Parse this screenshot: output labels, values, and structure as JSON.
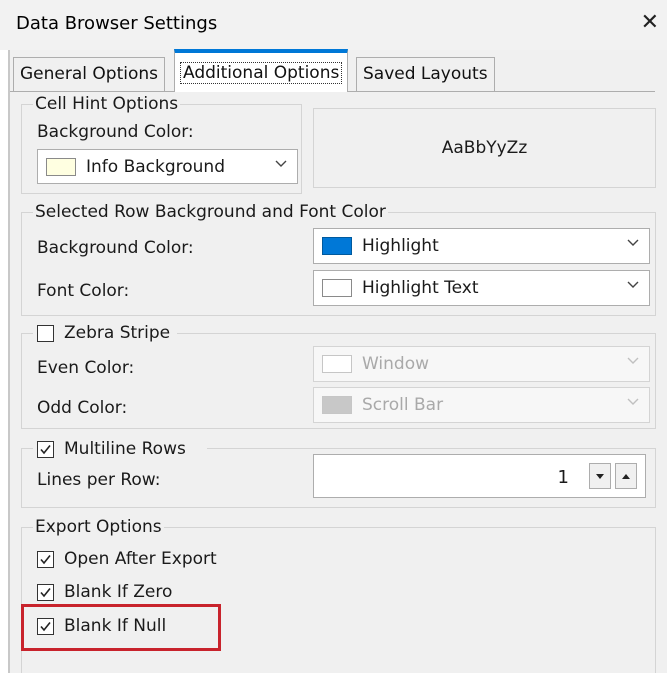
{
  "window": {
    "title": "Data Browser Settings",
    "close_glyph": "✕"
  },
  "tabs": [
    {
      "label": "General Options",
      "active": false
    },
    {
      "label": "Additional Options",
      "active": true
    },
    {
      "label": "Saved Layouts",
      "active": false
    }
  ],
  "cell_hint": {
    "group_title": "Cell Hint Options",
    "bg_label": "Background Color:",
    "bg_value": "Info Background",
    "bg_swatch": "#ffffe1",
    "preview_text": "AaBbYyZz"
  },
  "selected_row": {
    "group_title": "Selected Row Background and Font Color",
    "bg_label": "Background Color:",
    "bg_value": "Highlight",
    "bg_swatch": "#0078d7",
    "font_label": "Font Color:",
    "font_value": "Highlight Text",
    "font_swatch": "#ffffff"
  },
  "zebra": {
    "checkbox_label": "Zebra Stripe",
    "checked": false,
    "even_label": "Even Color:",
    "even_value": "Window",
    "even_swatch": "#ffffff",
    "odd_label": "Odd Color:",
    "odd_value": "Scroll Bar",
    "odd_swatch": "#c8c8c8"
  },
  "multiline": {
    "checkbox_label": "Multiline Rows",
    "checked": true,
    "lines_label": "Lines per Row:",
    "lines_value": "1"
  },
  "export": {
    "group_title": "Export Options",
    "open_after_label": "Open After Export",
    "open_after_checked": true,
    "blank_zero_label": "Blank If Zero",
    "blank_zero_checked": true,
    "blank_null_label": "Blank If Null",
    "blank_null_checked": true
  },
  "colors": {
    "accent_tab": "#0078d7",
    "annotation_red": "#c8232c"
  }
}
